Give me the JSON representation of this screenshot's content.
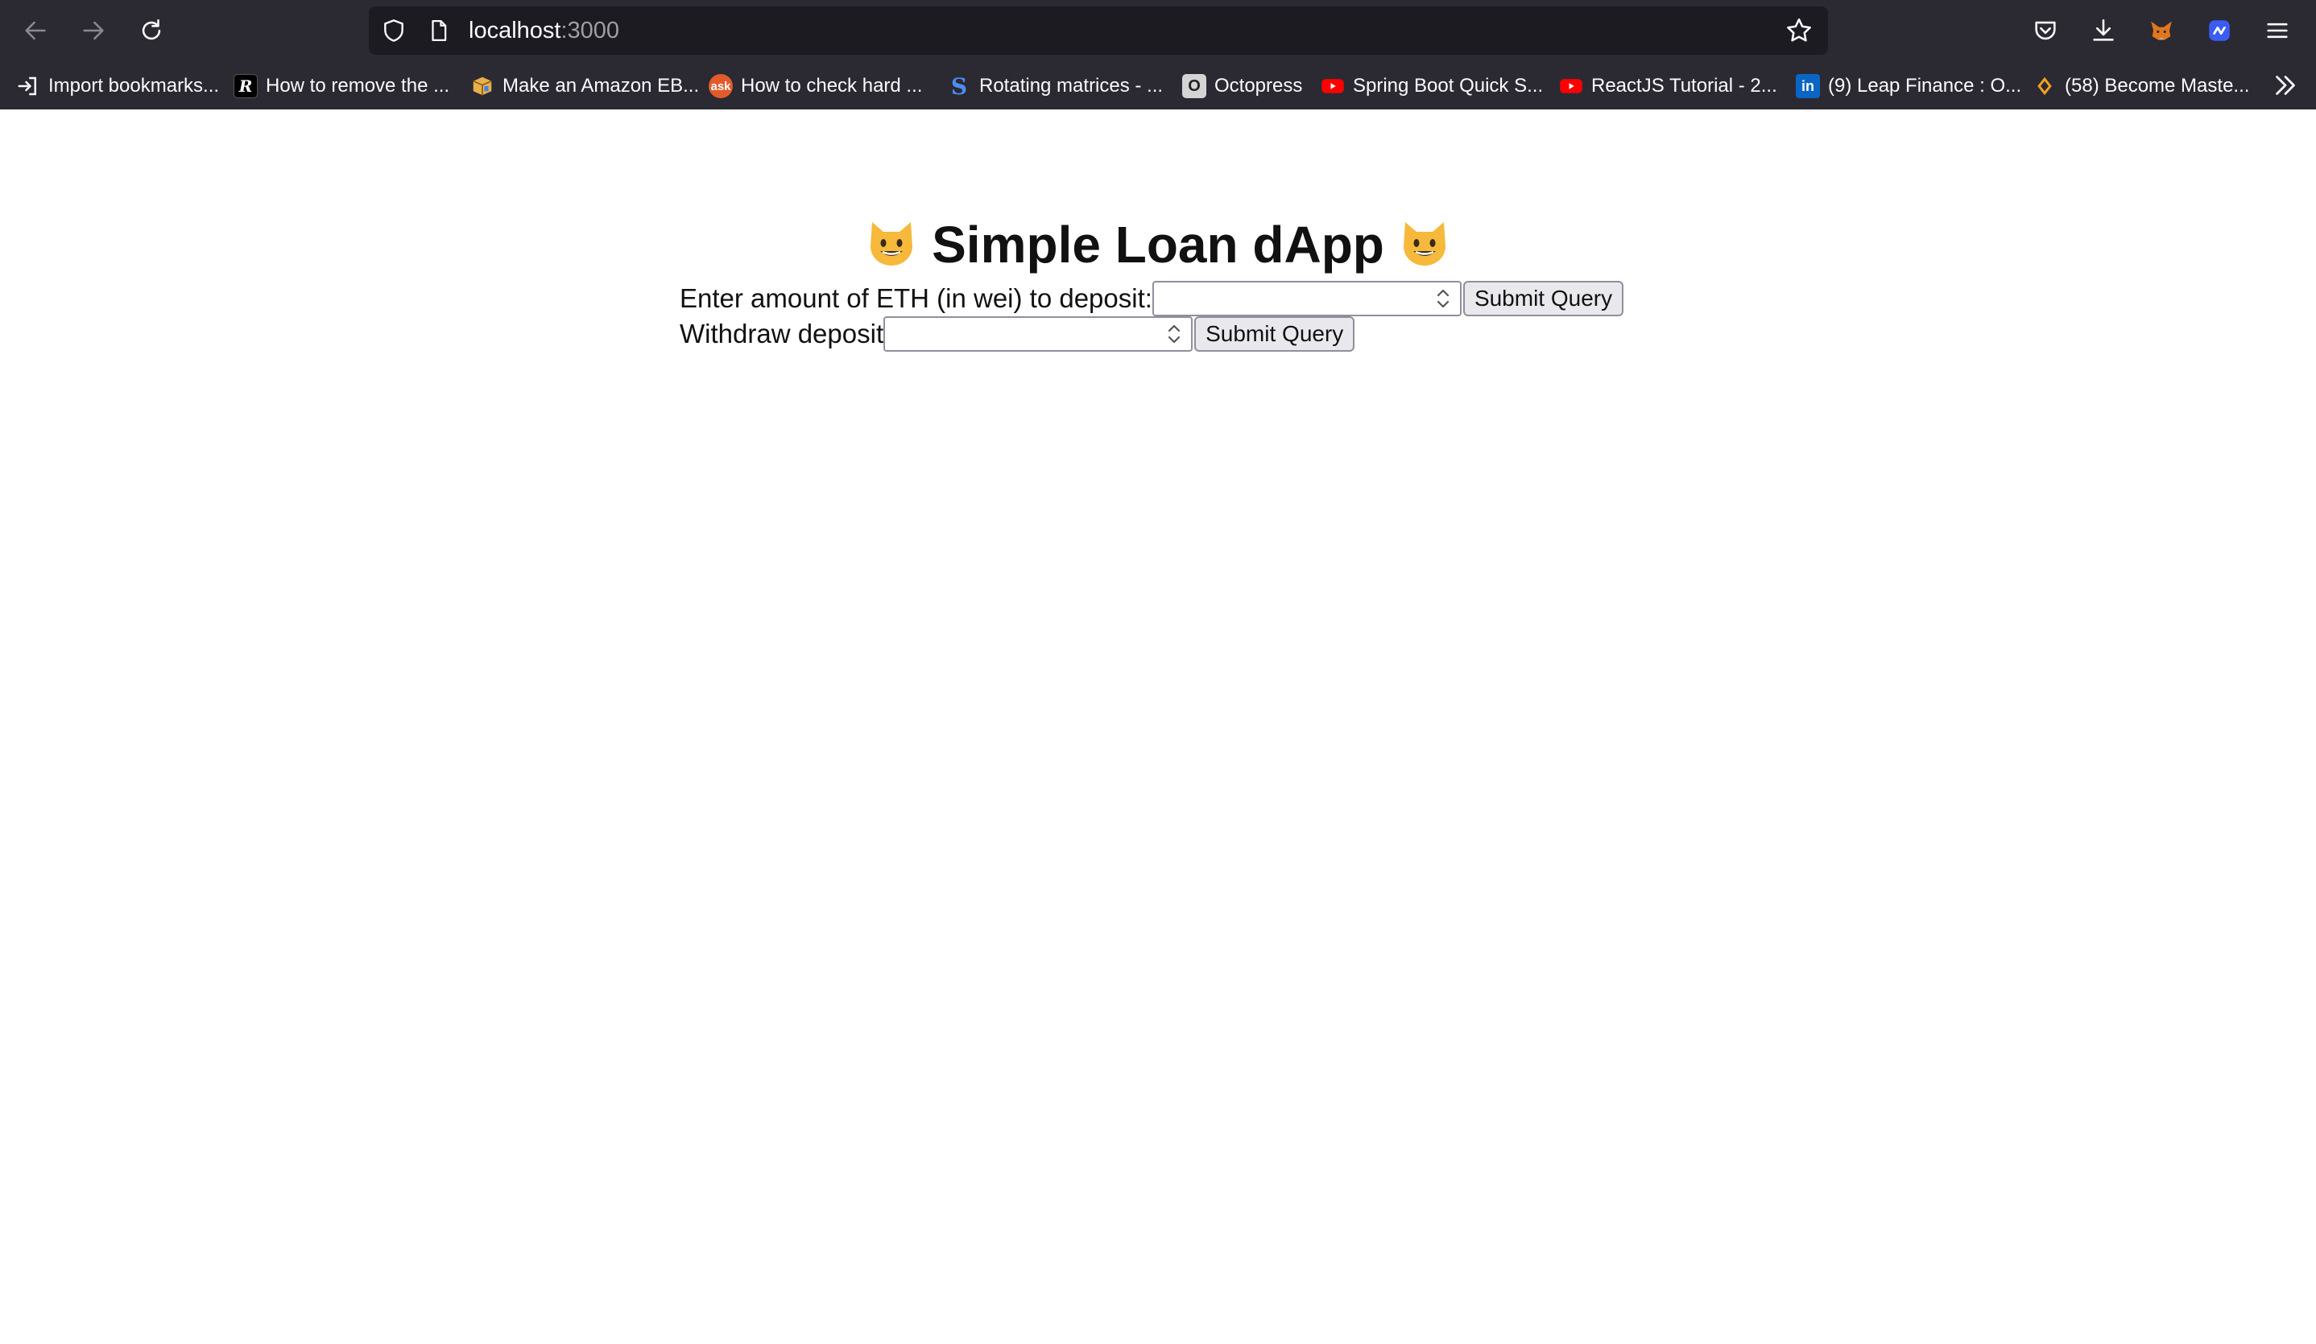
{
  "browser": {
    "url_host": "localhost",
    "url_port": ":3000",
    "toolbar_icons": [
      "back-arrow-icon",
      "forward-arrow-icon",
      "reload-icon",
      "shield-icon",
      "page-icon",
      "star-icon",
      "pocket-icon",
      "download-icon",
      "metamask-fox-icon",
      "extension-icon",
      "menu-icon"
    ],
    "bookmarks": [
      {
        "label": "Import bookmarks...",
        "icon": "import-icon"
      },
      {
        "label": "How to remove the ...",
        "icon": "r-logo-icon"
      },
      {
        "label": "Make an Amazon EB...",
        "icon": "box-icon"
      },
      {
        "label": "How to check hard ...",
        "icon": "ask-icon"
      },
      {
        "label": "Rotating matrices - ...",
        "icon": "s-logo-icon"
      },
      {
        "label": "Octopress",
        "icon": "octopress-icon"
      },
      {
        "label": "Spring Boot Quick S...",
        "icon": "youtube-icon"
      },
      {
        "label": "ReactJS Tutorial - 2...",
        "icon": "youtube-icon"
      },
      {
        "label": "(9) Leap Finance : O...",
        "icon": "linkedin-icon"
      },
      {
        "label": "(58) Become Maste...",
        "icon": "bookmark-favicon-icon"
      }
    ],
    "overflow_icon": "chevron-double-right-icon"
  },
  "page": {
    "title": "Simple Loan dApp",
    "deposit": {
      "label": "Enter amount of ETH (in wei) to deposit:",
      "value": "",
      "button_label": "Submit Query"
    },
    "withdraw": {
      "label": "Withdraw deposit",
      "value": "",
      "button_label": "Submit Query"
    }
  }
}
